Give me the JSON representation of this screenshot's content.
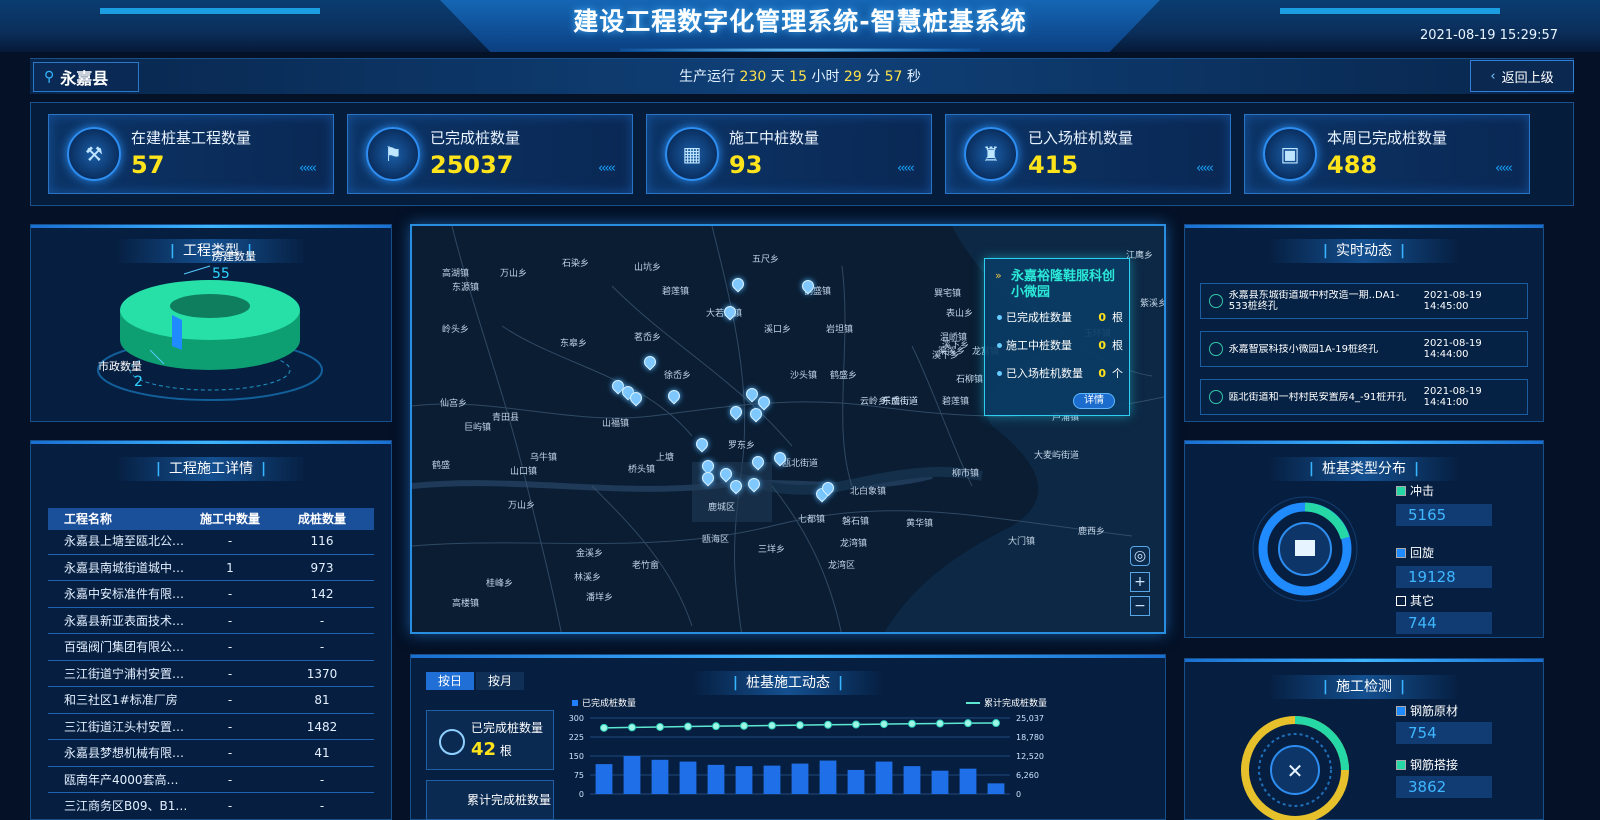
{
  "header": {
    "title": "建设工程数字化管理系统-智慧桩基系统",
    "datetime": "2021-08-19 15:29:57"
  },
  "region": {
    "label": "永嘉县"
  },
  "runtime": {
    "prefix": "生产运行",
    "days": "230",
    "days_unit": "天",
    "hours": "15",
    "hours_unit": "小时",
    "minutes": "29",
    "minutes_unit": "分",
    "seconds": "57",
    "seconds_unit": "秒"
  },
  "back_button": {
    "label": "返回上级"
  },
  "stats": [
    {
      "label": "在建桩基工程数量",
      "value": "57",
      "icon": "crane-icon"
    },
    {
      "label": "已完成桩数量",
      "value": "25037",
      "icon": "flag-icon"
    },
    {
      "label": "施工中桩数量",
      "value": "93",
      "icon": "grid-icon"
    },
    {
      "label": "已入场桩机数量",
      "value": "415",
      "icon": "pile-machine-icon"
    },
    {
      "label": "本周已完成桩数量",
      "value": "488",
      "icon": "calendar-icon"
    }
  ],
  "project_type": {
    "title": "工程类型",
    "housing_label": "房建数量",
    "housing_value": "55",
    "municipal_label": "市政数量",
    "municipal_value": "2",
    "colors": {
      "housing": "#1fd6a3",
      "municipal": "#1f8bff"
    }
  },
  "project_detail": {
    "title": "工程施工详情",
    "columns": [
      "工程名称",
      "施工中数量",
      "成桩数量"
    ],
    "rows": [
      [
        "永嘉县上塘至瓯北公路安...",
        "-",
        "116"
      ],
      [
        "永嘉县南城街道城中村改...",
        "1",
        "973"
      ],
      [
        "永嘉中安标准件有限公司...",
        "-",
        "142"
      ],
      [
        "永嘉县新亚表面技术处理...",
        "-",
        "-"
      ],
      [
        "百强阀门集团有限公司厂...",
        "-",
        "-"
      ],
      [
        "三江街道宁浦村安置房项目",
        "-",
        "1370"
      ],
      [
        "和三社区1#标准厂房",
        "-",
        "81"
      ],
      [
        "三江街道江头村安置房项...",
        "-",
        "1482"
      ],
      [
        "永嘉县梦想机械有限公司...",
        "-",
        "41"
      ],
      [
        "瓯南年产4000套高端智...",
        "-",
        "-"
      ],
      [
        "三江商务区B09、B11地...",
        "-",
        "-"
      ]
    ]
  },
  "map": {
    "labels": [
      [
        "石染乡",
        150,
        30
      ],
      [
        "山坑乡",
        222,
        34
      ],
      [
        "五尺乡",
        340,
        26
      ],
      [
        "鹤盛镇",
        392,
        58
      ],
      [
        "高湖镇",
        30,
        40
      ],
      [
        "东源镇",
        40,
        54
      ],
      [
        "万山乡",
        88,
        40
      ],
      [
        "碧莲镇",
        250,
        58
      ],
      [
        "大若岩镇",
        294,
        80
      ],
      [
        "溪口乡",
        352,
        96
      ],
      [
        "岩坦镇",
        414,
        96
      ],
      [
        "表山乡",
        534,
        80
      ],
      [
        "巽宅镇",
        522,
        60
      ],
      [
        "岭头乡",
        30,
        96
      ],
      [
        "东皋乡",
        148,
        110
      ],
      [
        "茗岙乡",
        222,
        104
      ],
      [
        "徐岙乡",
        252,
        142
      ],
      [
        "沙头镇",
        378,
        142
      ],
      [
        "鹤盛乡",
        418,
        142
      ],
      [
        "溪下乡",
        530,
        112
      ],
      [
        "溪下乡",
        520,
        122
      ],
      [
        "渠溪乡",
        526,
        118
      ],
      [
        "石柳镇",
        544,
        146
      ],
      [
        "碧莲镇",
        530,
        168
      ],
      [
        "龙富镇",
        560,
        118
      ],
      [
        "云岭乡",
        448,
        168
      ],
      [
        "东岙街道",
        470,
        168
      ],
      [
        "山福镇",
        190,
        190
      ],
      [
        "罗东乡",
        316,
        212
      ],
      [
        "乌牛镇",
        118,
        224
      ],
      [
        "上塘",
        244,
        224
      ],
      [
        "桥头镇",
        216,
        236
      ],
      [
        "瓯北街道",
        370,
        230
      ],
      [
        "北白象镇",
        438,
        258
      ],
      [
        "鹿城区",
        296,
        274
      ],
      [
        "七都镇",
        386,
        286
      ],
      [
        "磐石镇",
        430,
        288
      ],
      [
        "瓯海区",
        290,
        306
      ],
      [
        "龙湾镇",
        428,
        310
      ],
      [
        "三垟乡",
        346,
        316
      ],
      [
        "龙湾区",
        416,
        332
      ],
      [
        "黄华镇",
        494,
        290
      ],
      [
        "大门镇",
        596,
        308
      ],
      [
        "鹿西乡",
        666,
        298
      ],
      [
        "青田县",
        80,
        184
      ],
      [
        "巨屿镇",
        52,
        194
      ],
      [
        "仙宫乡",
        28,
        170
      ],
      [
        "山口镇",
        98,
        238
      ],
      [
        "万山乡",
        96,
        272
      ],
      [
        "鹤盛",
        20,
        232
      ],
      [
        "金溪乡",
        164,
        320
      ],
      [
        "林溪乡",
        162,
        344
      ],
      [
        "桂峰乡",
        74,
        350
      ],
      [
        "潘垟乡",
        174,
        364
      ],
      [
        "高楼镇",
        40,
        370
      ],
      [
        "老竹畲",
        220,
        332
      ],
      [
        "大麦屿街道",
        622,
        222
      ],
      [
        "芦浦镇",
        640,
        184
      ],
      [
        "温峤镇",
        528,
        104
      ],
      [
        "玉环镇",
        672,
        100
      ],
      [
        "柳市镇",
        540,
        240
      ],
      [
        "乐成街道",
        470,
        168
      ],
      [
        "江鹰乡",
        714,
        22
      ],
      [
        "紫溪乡",
        728,
        70
      ]
    ],
    "popup": {
      "title": "永嘉裕隆鞋服科创小微园",
      "rows": [
        {
          "label": "已完成桩数量",
          "value": "0",
          "unit": "根"
        },
        {
          "label": "施工中桩数量",
          "value": "0",
          "unit": "根"
        },
        {
          "label": "已入场桩机数量",
          "value": "0",
          "unit": "个"
        }
      ],
      "detail_label": "详情"
    }
  },
  "realtime": {
    "title": "实时动态",
    "items": [
      {
        "text": "永嘉县东城街道城中村改造一期..DA1-533桩终孔",
        "time": "2021-08-19 14:45:00"
      },
      {
        "text": "永嘉智宸科技小微园1A-19桩终孔",
        "time": "2021-08-19 14:44:00"
      },
      {
        "text": "瓯北街道和一村村民安置房4_-91桩开孔",
        "time": "2021-08-19 14:41:00"
      }
    ]
  },
  "pile_type": {
    "title": "桩基类型分布",
    "items": [
      {
        "label": "冲击",
        "value": "5165",
        "color": "#25d8a6"
      },
      {
        "label": "回旋",
        "value": "19128",
        "color": "#1f8bff"
      },
      {
        "label": "其它",
        "value": "744",
        "color": "#ffffff"
      }
    ]
  },
  "inspection": {
    "title": "施工检测",
    "items": [
      {
        "label": "钢筋原材",
        "value": "754",
        "color": "#1f8bff"
      },
      {
        "label": "钢筋搭接",
        "value": "3862",
        "color": "#25d8a6"
      }
    ]
  },
  "pile_dynamics": {
    "title": "桩基施工动态",
    "tabs": [
      "按日",
      "按月"
    ],
    "legend_bar": "已完成桩数量",
    "legend_line": "累计完成桩数量",
    "completed_label": "已完成桩数量",
    "completed_value": "42",
    "completed_unit": "根",
    "cumulative_label": "累计完成桩数量"
  },
  "chart_data": {
    "type": "bar",
    "title": "桩基施工动态",
    "series": [
      {
        "name": "已完成桩数量",
        "type": "bar",
        "values": [
          118,
          150,
          135,
          128,
          115,
          110,
          112,
          120,
          132,
          95,
          128,
          110,
          92,
          100,
          42
        ]
      },
      {
        "name": "累计完成桩数量",
        "type": "line",
        "values": [
          21800,
          21950,
          22090,
          22220,
          22340,
          22450,
          22560,
          22680,
          22810,
          22900,
          23030,
          23140,
          23230,
          23330,
          23370
        ]
      }
    ],
    "y_left_ticks": [
      "300",
      "225",
      "150",
      "75",
      "0"
    ],
    "y_right_ticks": [
      "25,037",
      "18,780",
      "12,520",
      "6,260",
      "0"
    ],
    "ylim_left": [
      0,
      300
    ],
    "ylim_right": [
      0,
      25037
    ]
  }
}
